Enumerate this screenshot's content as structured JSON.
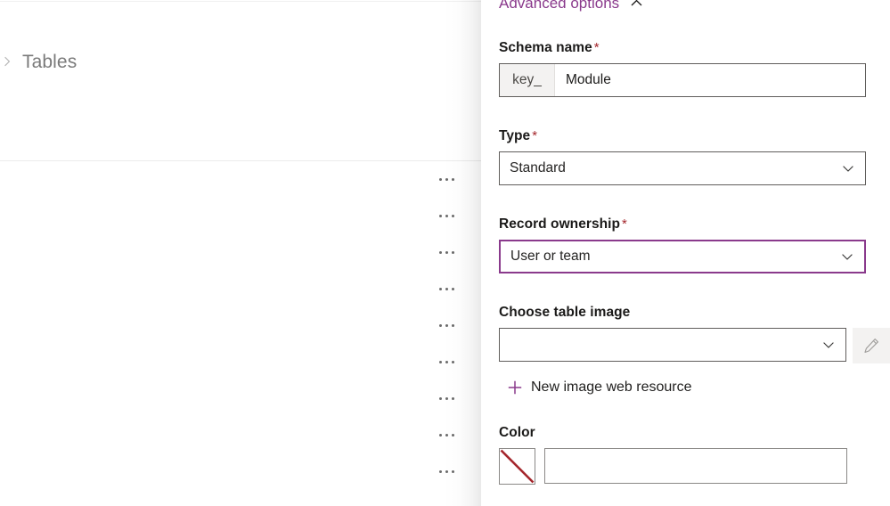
{
  "background": {
    "breadcrumb": {
      "chevron_icon": "chevron-right-icon",
      "label": "Tables"
    },
    "rows": [
      {
        "menu": "⋯"
      },
      {
        "menu": "⋯"
      },
      {
        "menu": "⋯"
      },
      {
        "menu": "⋯"
      },
      {
        "menu": "⋯"
      },
      {
        "menu": "⋯"
      },
      {
        "menu": "⋯"
      },
      {
        "menu": "⋯"
      },
      {
        "menu": "⋯"
      }
    ]
  },
  "panel": {
    "advanced_options": {
      "label": "Advanced options",
      "collapse_icon": "chevron-up-icon",
      "accent_color": "#8a3a8c"
    },
    "schema_name": {
      "label": "Schema name",
      "required": "*",
      "prefix": "key_",
      "value": "Module"
    },
    "type": {
      "label": "Type",
      "required": "*",
      "value": "Standard",
      "caret_icon": "chevron-down-icon"
    },
    "record_ownership": {
      "label": "Record ownership",
      "required": "*",
      "value": "User or team",
      "caret_icon": "chevron-down-icon",
      "focused": true,
      "focus_color": "#8a3a8c"
    },
    "choose_table_image": {
      "label": "Choose table image",
      "value": "",
      "caret_icon": "chevron-down-icon",
      "edit_icon": "pencil-icon",
      "edit_disabled": true,
      "new_resource_link": "New image web resource",
      "new_resource_icon": "plus-icon"
    },
    "color": {
      "label": "Color",
      "swatch_icon": "no-color-diagonal-icon",
      "swatch_line_color": "#a4262c",
      "value": ""
    }
  },
  "theme": {
    "required_asterisk_color": "#a4262c",
    "border_color": "#605e5c",
    "accent_purple": "#8a3a8c"
  }
}
